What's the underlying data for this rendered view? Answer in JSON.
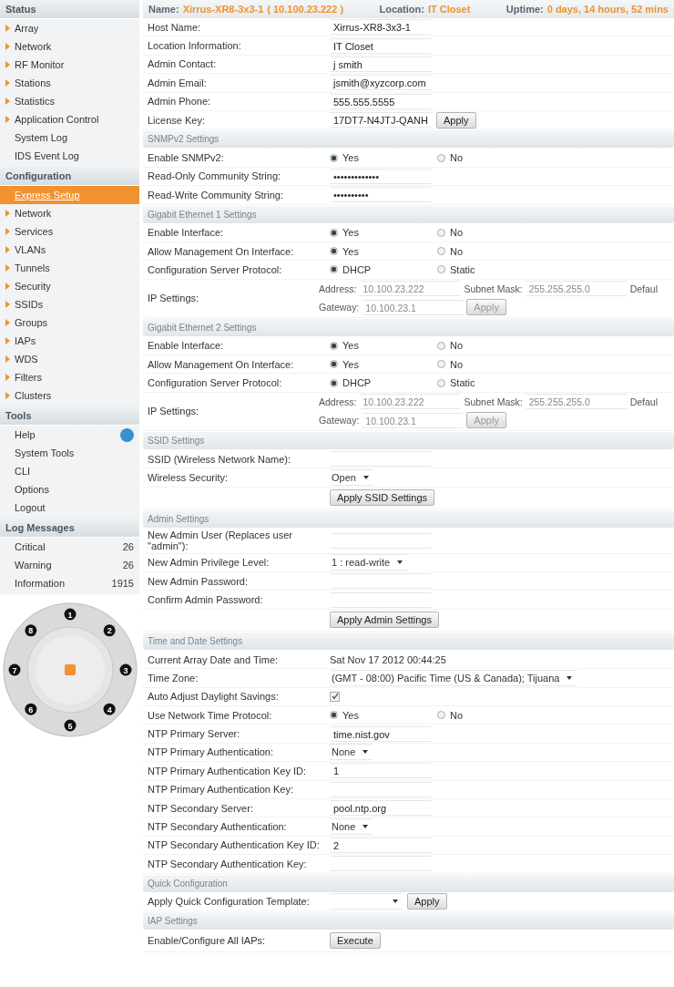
{
  "sidebar": {
    "groups": [
      {
        "title": "Status",
        "items": [
          {
            "label": "Array",
            "kind": "arrow",
            "selected": false
          },
          {
            "label": "Network",
            "kind": "arrow",
            "selected": false
          },
          {
            "label": "RF Monitor",
            "kind": "arrow",
            "selected": false
          },
          {
            "label": "Stations",
            "kind": "arrow",
            "selected": false
          },
          {
            "label": "Statistics",
            "kind": "arrow",
            "selected": false
          },
          {
            "label": "Application Control",
            "kind": "arrow",
            "selected": false
          },
          {
            "label": "System Log",
            "kind": "plain",
            "selected": false
          },
          {
            "label": "IDS Event Log",
            "kind": "plain",
            "selected": false
          }
        ]
      },
      {
        "title": "Configuration",
        "items": [
          {
            "label": "Express Setup",
            "kind": "plain",
            "selected": true
          },
          {
            "label": "Network",
            "kind": "arrow",
            "selected": false
          },
          {
            "label": "Services",
            "kind": "arrow",
            "selected": false
          },
          {
            "label": "VLANs",
            "kind": "arrow",
            "selected": false
          },
          {
            "label": "Tunnels",
            "kind": "arrow",
            "selected": false
          },
          {
            "label": "Security",
            "kind": "arrow",
            "selected": false
          },
          {
            "label": "SSIDs",
            "kind": "arrow",
            "selected": false
          },
          {
            "label": "Groups",
            "kind": "arrow",
            "selected": false
          },
          {
            "label": "IAPs",
            "kind": "arrow",
            "selected": false
          },
          {
            "label": "WDS",
            "kind": "arrow",
            "selected": false
          },
          {
            "label": "Filters",
            "kind": "arrow",
            "selected": false
          },
          {
            "label": "Clusters",
            "kind": "arrow",
            "selected": false
          }
        ]
      },
      {
        "title": "Tools",
        "items": [
          {
            "label": "Help",
            "kind": "help",
            "selected": false
          },
          {
            "label": "System Tools",
            "kind": "plain",
            "selected": false
          },
          {
            "label": "CLI",
            "kind": "plain",
            "selected": false
          },
          {
            "label": "Options",
            "kind": "plain",
            "selected": false
          },
          {
            "label": "Logout",
            "kind": "plain",
            "selected": false
          }
        ]
      },
      {
        "title": "Log Messages",
        "items": [
          {
            "label": "Critical",
            "kind": "count",
            "count": "26",
            "selected": false
          },
          {
            "label": "Warning",
            "kind": "count",
            "count": "26",
            "selected": false
          },
          {
            "label": "Information",
            "kind": "count",
            "count": "1915",
            "selected": false
          }
        ]
      }
    ]
  },
  "dial": {
    "ports": [
      "1",
      "2",
      "3",
      "4",
      "5",
      "6",
      "7",
      "8"
    ]
  },
  "device_header": {
    "name_label": "Name:",
    "name": "Xirrus-XR8-3x3-1",
    "ip": "( 10.100.23.222 )",
    "location_label": "Location:",
    "location": "IT Closet",
    "uptime_label": "Uptime:",
    "uptime": "0 days, 14 hours, 52 mins"
  },
  "sections": [
    {
      "rows": [
        {
          "label": "Host Name:",
          "kind": "text",
          "value": "Xirrus-XR8-3x3-1"
        },
        {
          "label": "Location Information:",
          "kind": "text",
          "value": "IT Closet"
        },
        {
          "label": "Admin Contact:",
          "kind": "text",
          "value": "j smith"
        },
        {
          "label": "Admin Email:",
          "kind": "text",
          "value": "jsmith@xyzcorp.com"
        },
        {
          "label": "Admin Phone:",
          "kind": "text",
          "value": "555.555.5555"
        },
        {
          "label": "License Key:",
          "kind": "text",
          "value": "17DT7-N4JTJ-QANH",
          "button": "Apply"
        }
      ]
    },
    {
      "title": "SNMPv2 Settings",
      "rows": [
        {
          "label": "Enable SNMPv2:",
          "kind": "radio",
          "options": [
            {
              "label": "Yes",
              "selected": true
            },
            {
              "label": "No",
              "selected": false
            }
          ]
        },
        {
          "label": "Read-Only Community String:",
          "kind": "text",
          "value": "•••••••••••••"
        },
        {
          "label": "Read-Write Community String:",
          "kind": "text",
          "value": "••••••••••"
        }
      ]
    },
    {
      "title": "Gigabit Ethernet 1 Settings",
      "rows": [
        {
          "label": "Enable Interface:",
          "kind": "radio",
          "options": [
            {
              "label": "Yes",
              "selected": true
            },
            {
              "label": "No",
              "selected": false
            }
          ]
        },
        {
          "label": "Allow Management On Interface:",
          "kind": "radio",
          "options": [
            {
              "label": "Yes",
              "selected": true
            },
            {
              "label": "No",
              "selected": false
            }
          ]
        },
        {
          "label": "Configuration Server Protocol:",
          "kind": "radio",
          "options": [
            {
              "label": "DHCP",
              "selected": true
            },
            {
              "label": "Static",
              "selected": false
            }
          ]
        },
        {
          "label": "IP Settings:",
          "kind": "ip",
          "disabled": true,
          "address_label": "Address:",
          "address": "10.100.23.222",
          "subnet_label": "Subnet Mask:",
          "subnet": "255.255.255.0",
          "default_label": "Defaul",
          "gateway_label": "Gateway:",
          "gateway": "10.100.23.1",
          "button": "Apply"
        }
      ]
    },
    {
      "title": "Gigabit Ethernet 2 Settings",
      "rows": [
        {
          "label": "Enable Interface:",
          "kind": "radio",
          "options": [
            {
              "label": "Yes",
              "selected": true
            },
            {
              "label": "No",
              "selected": false
            }
          ]
        },
        {
          "label": "Allow Management On Interface:",
          "kind": "radio",
          "options": [
            {
              "label": "Yes",
              "selected": true
            },
            {
              "label": "No",
              "selected": false
            }
          ]
        },
        {
          "label": "Configuration Server Protocol:",
          "kind": "radio",
          "options": [
            {
              "label": "DHCP",
              "selected": true
            },
            {
              "label": "Static",
              "selected": false
            }
          ]
        },
        {
          "label": "IP Settings:",
          "kind": "ip",
          "disabled": true,
          "address_label": "Address:",
          "address": "10.100.23.222",
          "subnet_label": "Subnet Mask:",
          "subnet": "255.255.255.0",
          "default_label": "Defaul",
          "gateway_label": "Gateway:",
          "gateway": "10.100.23.1",
          "button": "Apply"
        }
      ]
    },
    {
      "title": "SSID Settings",
      "rows": [
        {
          "label": "SSID (Wireless Network Name):",
          "kind": "text"
        },
        {
          "label": "Wireless Security:",
          "kind": "select",
          "value": "Open"
        },
        {
          "kind": "button",
          "button": "Apply SSID Settings"
        }
      ]
    },
    {
      "title": "Admin Settings",
      "rows": [
        {
          "label": "New Admin User (Replaces user \"admin\"):",
          "kind": "text"
        },
        {
          "label": "New Admin Privilege Level:",
          "kind": "select",
          "value": "1 : read-write"
        },
        {
          "label": "New Admin Password:",
          "kind": "text"
        },
        {
          "label": "Confirm Admin Password:",
          "kind": "text"
        },
        {
          "kind": "button",
          "button": "Apply Admin Settings"
        }
      ]
    },
    {
      "title": "Time and Date Settings",
      "rows": [
        {
          "label": "Current Array Date and Time:",
          "kind": "static",
          "value": "Sat Nov 17 2012 00:44:25"
        },
        {
          "label": "Time Zone:",
          "kind": "select",
          "value": "(GMT - 08:00) Pacific Time (US & Canada); Tijuana"
        },
        {
          "label": "Auto Adjust Daylight Savings:",
          "kind": "checkbox",
          "checked": true
        },
        {
          "label": "Use Network Time Protocol:",
          "kind": "radio",
          "options": [
            {
              "label": "Yes",
              "selected": true
            },
            {
              "label": "No",
              "selected": false
            }
          ]
        },
        {
          "label": "NTP Primary Server:",
          "kind": "text",
          "value": "time.nist.gov"
        },
        {
          "label": "NTP Primary Authentication:",
          "kind": "select",
          "value": "None"
        },
        {
          "label": "NTP Primary Authentication Key ID:",
          "kind": "text",
          "value": "1"
        },
        {
          "label": "NTP Primary Authentication Key:",
          "kind": "text"
        },
        {
          "label": "NTP Secondary Server:",
          "kind": "text",
          "value": "pool.ntp.org"
        },
        {
          "label": "NTP Secondary Authentication:",
          "kind": "select",
          "value": "None"
        },
        {
          "label": "NTP Secondary Authentication Key ID:",
          "kind": "text",
          "value": "2"
        },
        {
          "label": "NTP Secondary Authentication Key:",
          "kind": "text"
        }
      ]
    },
    {
      "title": "Quick Configuration",
      "rows": [
        {
          "label": "Apply Quick Configuration Template:",
          "kind": "select",
          "button": "Apply"
        }
      ]
    },
    {
      "title": "IAP Settings",
      "rows": [
        {
          "label": "Enable/Configure All IAPs:",
          "kind": "button",
          "button": "Execute"
        }
      ]
    }
  ]
}
